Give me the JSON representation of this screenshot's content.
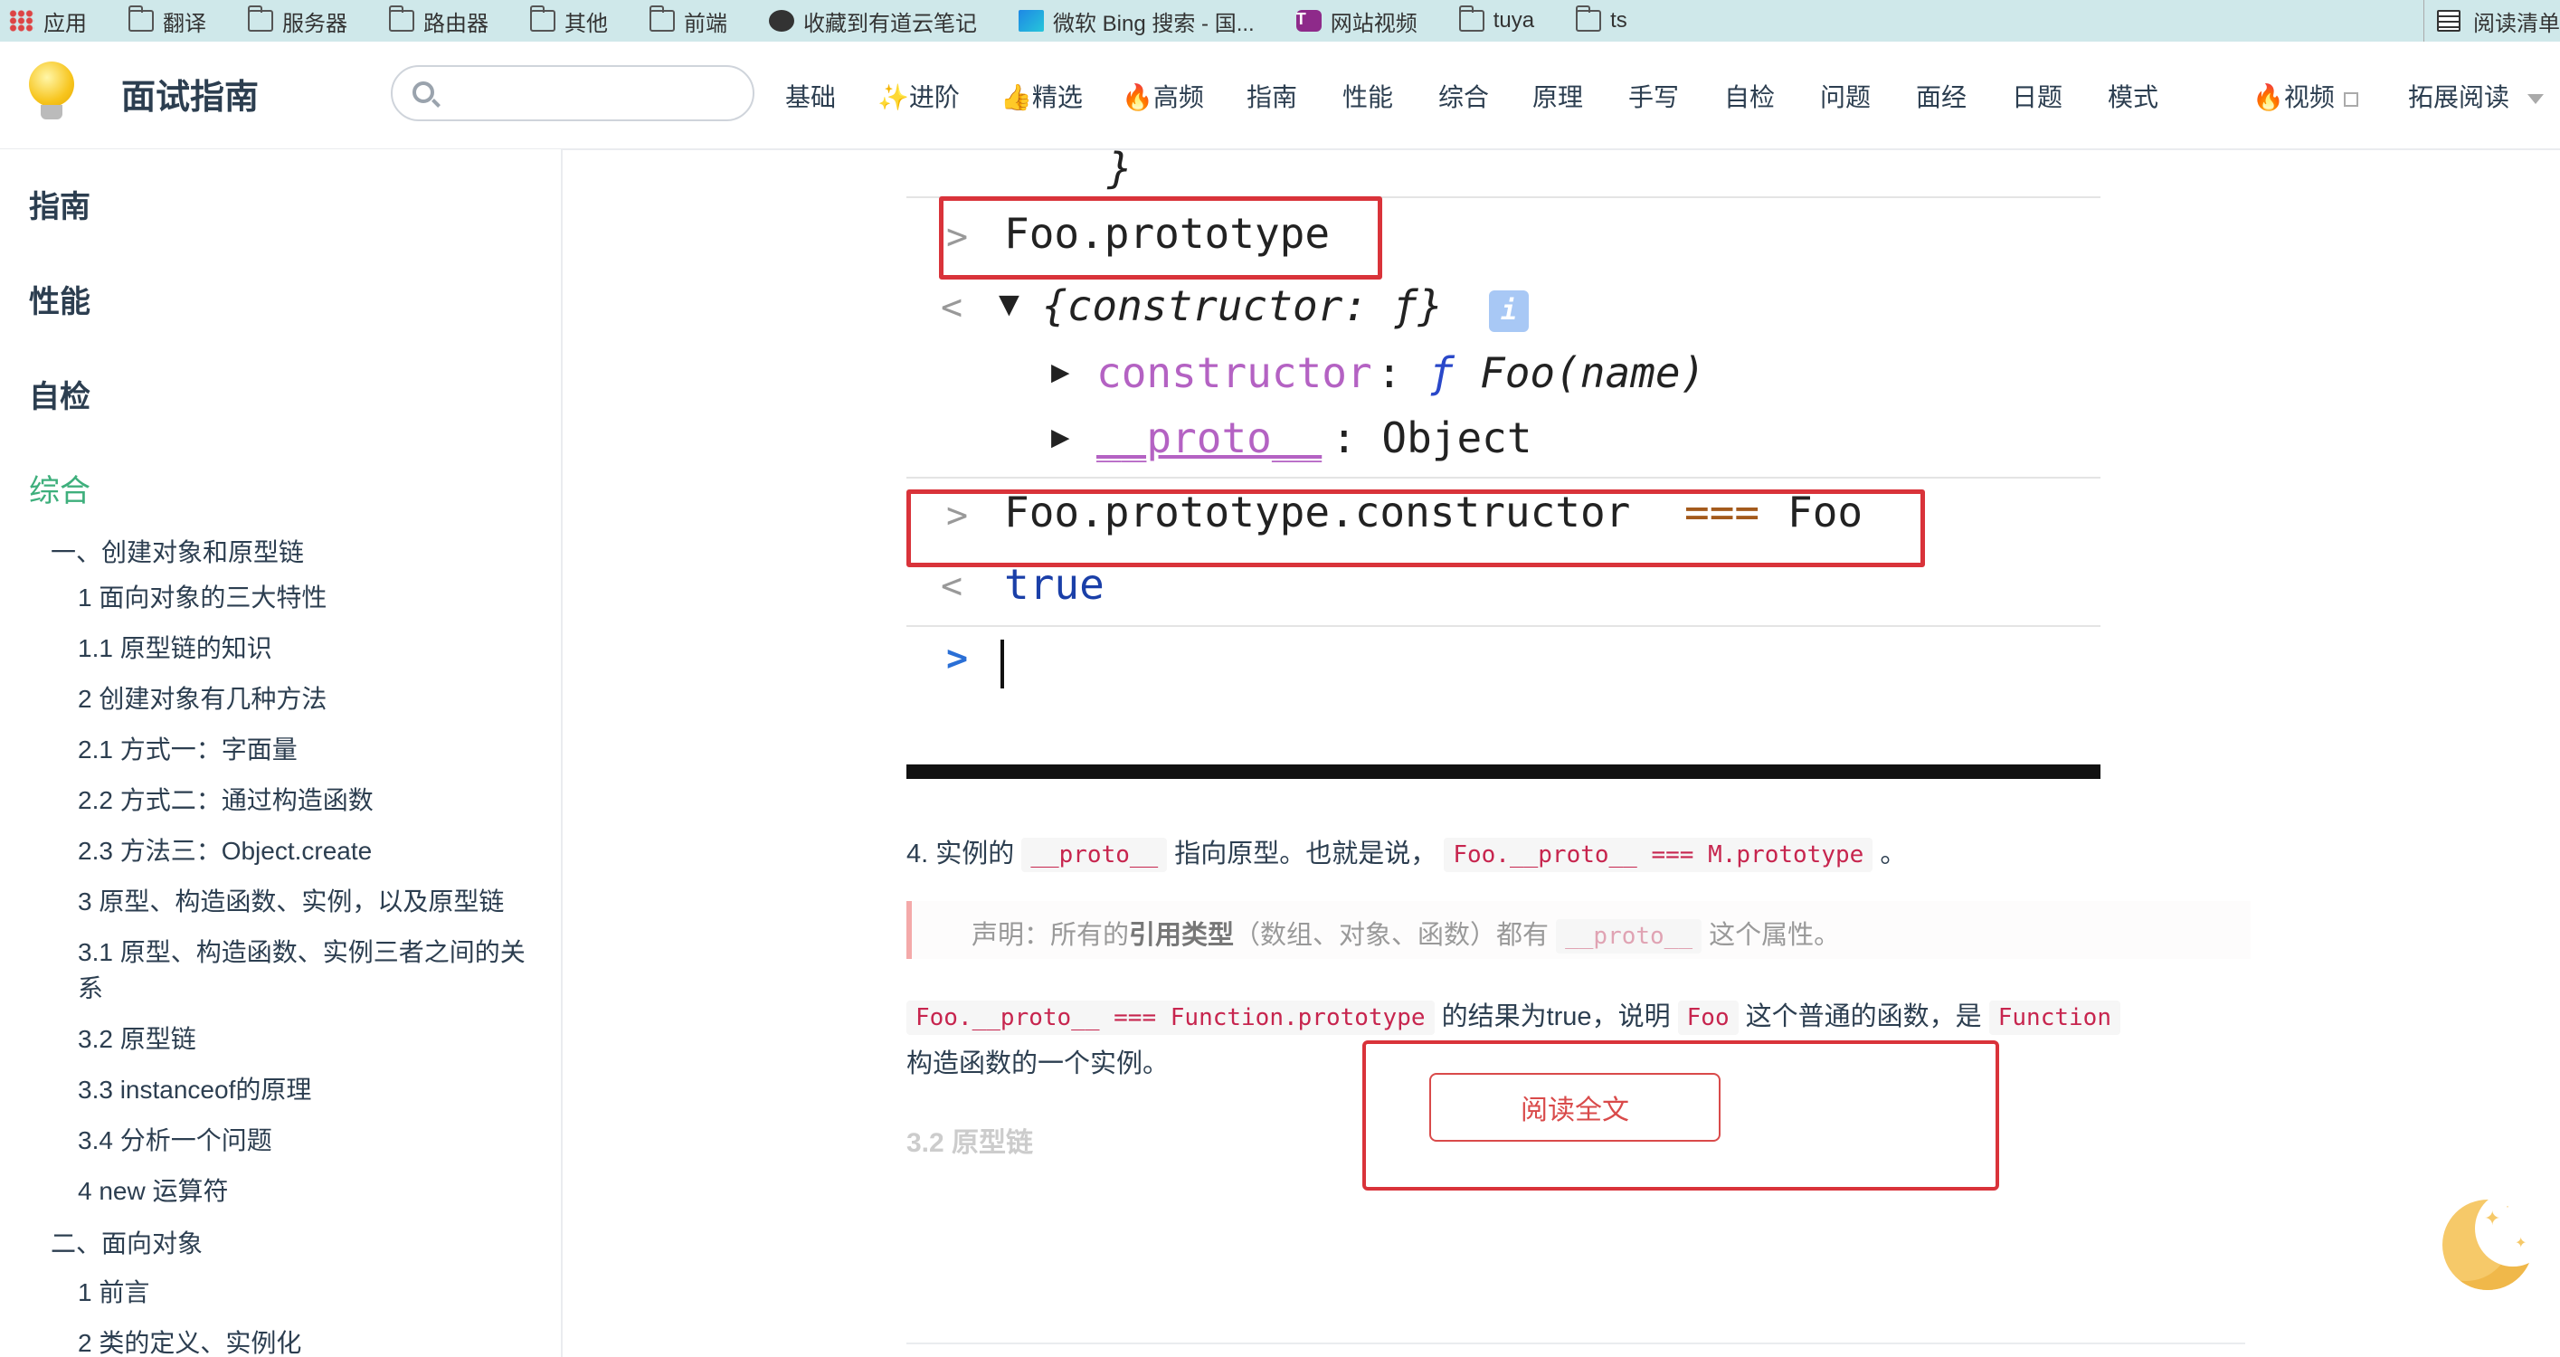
{
  "bookmarks": {
    "items": [
      {
        "label": "应用",
        "icon": "apps-icon"
      },
      {
        "label": "翻译",
        "icon": "folder-icon"
      },
      {
        "label": "服务器",
        "icon": "folder-icon"
      },
      {
        "label": "路由器",
        "icon": "folder-icon"
      },
      {
        "label": "其他",
        "icon": "folder-icon"
      },
      {
        "label": "前端",
        "icon": "folder-icon"
      },
      {
        "label": "收藏到有道云笔记",
        "icon": "globe-icon"
      },
      {
        "label": "微软 Bing 搜索 - 国...",
        "icon": "bing-icon"
      },
      {
        "label": "网站视频",
        "icon": "video-icon"
      },
      {
        "label": "tuya",
        "icon": "folder-icon"
      },
      {
        "label": "ts",
        "icon": "folder-icon"
      }
    ],
    "reading_list": "阅读清单"
  },
  "navbar": {
    "site_title": "面试指南",
    "search_placeholder": "",
    "links": [
      "基础",
      "✨进阶",
      "👍精选",
      "🔥高频",
      "指南",
      "性能",
      "综合",
      "原理",
      "手写",
      "自检",
      "问题",
      "面经",
      "日题",
      "模式"
    ],
    "video_link": "🔥视频",
    "extended_reading": "拓展阅读"
  },
  "sidebar": {
    "sections": [
      "指南",
      "性能",
      "自检",
      "综合"
    ],
    "active_section": "综合",
    "group1_title": "一、创建对象和原型链",
    "group1_items": [
      "1 面向对象的三大特性",
      "1.1 原型链的知识",
      "2 创建对象有几种方法",
      "2.1 方式一：字面量",
      "2.2 方式二：通过构造函数",
      "2.3 方法三：Object.create",
      "3 原型、构造函数、实例，以及原型链",
      "3.1 原型、构造函数、实例三者之间的关系",
      "3.2 原型链",
      "3.3 instanceof的原理",
      "3.4 分析一个问题",
      "4 new 运算符"
    ],
    "group2_title": "二、面向对象",
    "group2_items": [
      "1 前言",
      "2 类的定义、实例化"
    ]
  },
  "console": {
    "closing_brace": "}",
    "cmd1": "Foo.prototype",
    "out1": "{constructor: ƒ}",
    "info_badge": "i",
    "prop1_key": "constructor",
    "prop1_colon": ":",
    "prop1_f": "ƒ",
    "prop1_val": "Foo(name)",
    "prop2_key": "__proto__",
    "prop2_val": ": Object",
    "cmd2_a": "Foo.prototype.constructor",
    "cmd2_op": "===",
    "cmd2_b": "Foo",
    "out2": "true",
    "prompt": ">",
    "prompt_left": "<",
    "expand_right": "▶",
    "expand_down": "▼"
  },
  "content": {
    "p1_prefix": "4. 实例的",
    "p1_code1": "__proto__",
    "p1_mid": "指向原型。也就是说，",
    "p1_code2": "Foo.__proto__ === M.prototype",
    "p1_end": "。",
    "quote_prefix": "声明：所有的",
    "quote_bold": "引用类型",
    "quote_mid": "（数组、对象、函数）都有",
    "quote_code": "__proto__",
    "quote_end": "这个属性。",
    "p2_code1": "Foo.__proto__ === Function.prototype",
    "p2_mid1": "的结果为true，说明",
    "p2_code2": "Foo",
    "p2_mid2": "这个普通的函数，是",
    "p2_code3": "Function",
    "p2_line2": "构造函数的一个实例。",
    "faded_heading": "3.2 原型链",
    "read_more": "阅读全文"
  }
}
